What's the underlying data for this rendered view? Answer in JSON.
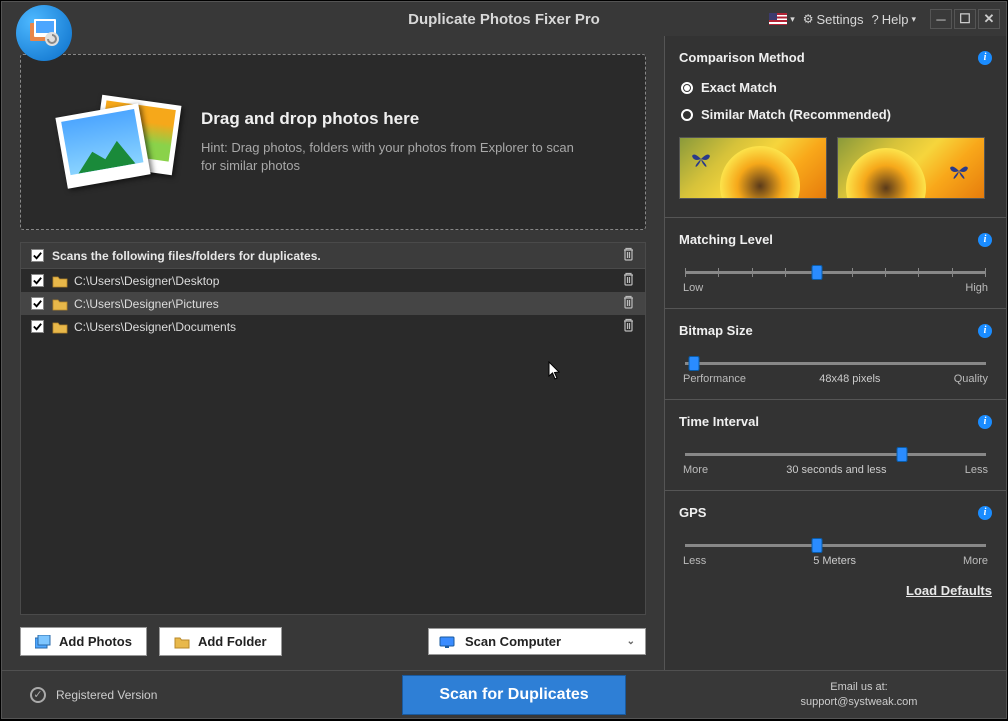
{
  "title": "Duplicate Photos Fixer Pro",
  "titlebar": {
    "settings": "Settings",
    "help": "Help"
  },
  "dropzone": {
    "title": "Drag and drop photos here",
    "hint": "Hint: Drag photos, folders with your photos from Explorer to scan for similar photos"
  },
  "list": {
    "header": "Scans the following files/folders for duplicates.",
    "rows": [
      {
        "path": "C:\\Users\\Designer\\Desktop",
        "checked": true
      },
      {
        "path": "C:\\Users\\Designer\\Pictures",
        "checked": true,
        "hover": true
      },
      {
        "path": "C:\\Users\\Designer\\Documents",
        "checked": true
      }
    ]
  },
  "buttons": {
    "add_photos": "Add Photos",
    "add_folder": "Add Folder",
    "scan_computer": "Scan Computer",
    "scan_duplicates": "Scan for Duplicates"
  },
  "side": {
    "comparison": "Comparison Method",
    "exact": "Exact Match",
    "similar": "Similar Match (Recommended)",
    "matching_level": {
      "title": "Matching Level",
      "left": "Low",
      "right": "High",
      "pos": 44
    },
    "bitmap_size": {
      "title": "Bitmap Size",
      "left": "Performance",
      "mid": "48x48 pixels",
      "right": "Quality",
      "pos": 3
    },
    "time_interval": {
      "title": "Time Interval",
      "left": "More",
      "mid": "30 seconds and less",
      "right": "Less",
      "pos": 72
    },
    "gps": {
      "title": "GPS",
      "left": "Less",
      "mid": "5 Meters",
      "right": "More",
      "pos": 44
    },
    "load_defaults": "Load Defaults"
  },
  "footer": {
    "registered": "Registered Version",
    "email_label": "Email us at:",
    "email": "support@systweak.com"
  }
}
